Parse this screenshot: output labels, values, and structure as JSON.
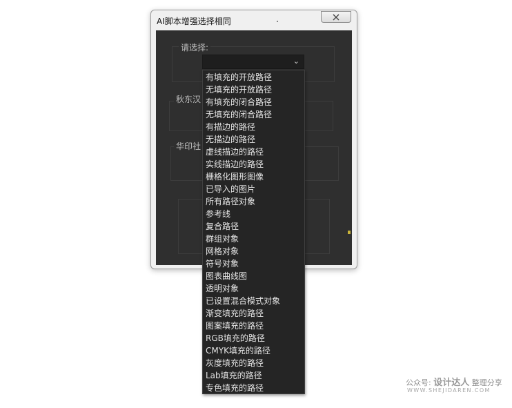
{
  "window": {
    "title": "AI脚本增强选择相同",
    "close_icon": "close-icon"
  },
  "sections": {
    "select_label": "请选择:",
    "author_label": "秋东汉",
    "publisher_label": "华印社"
  },
  "dropdown": {
    "selected_value": "",
    "chevron_icon": "chevron-down-icon",
    "options": [
      "有填充的开放路径",
      "无填充的开放路径",
      "有填充的闭合路径",
      "无填充的闭合路径",
      "有描边的路径",
      "无描边的路径",
      "虚线描边的路径",
      "实线描边的路径",
      "栅格化图形图像",
      "已导入的图片",
      "所有路径对象",
      "参考线",
      "复合路径",
      "群组对象",
      "网格对象",
      "符号对象",
      "图表曲线图",
      "透明对象",
      "已设置混合模式对象",
      "渐变填充的路径",
      "图案填充的路径",
      "RGB填充的路径",
      "CMYK填充的路径",
      "灰度填充的路径",
      "Lab填充的路径",
      "专色填充的路径"
    ]
  },
  "watermark": {
    "prefix": "公众号:",
    "brand": "设计达人",
    "suffix": "整理分享",
    "url": "WWW.SHEJIDAREN.COM"
  },
  "colors": {
    "panel_bg": "#2f2f2f",
    "dropdown_bg": "#252525",
    "option_text": "#e4e4e4"
  }
}
